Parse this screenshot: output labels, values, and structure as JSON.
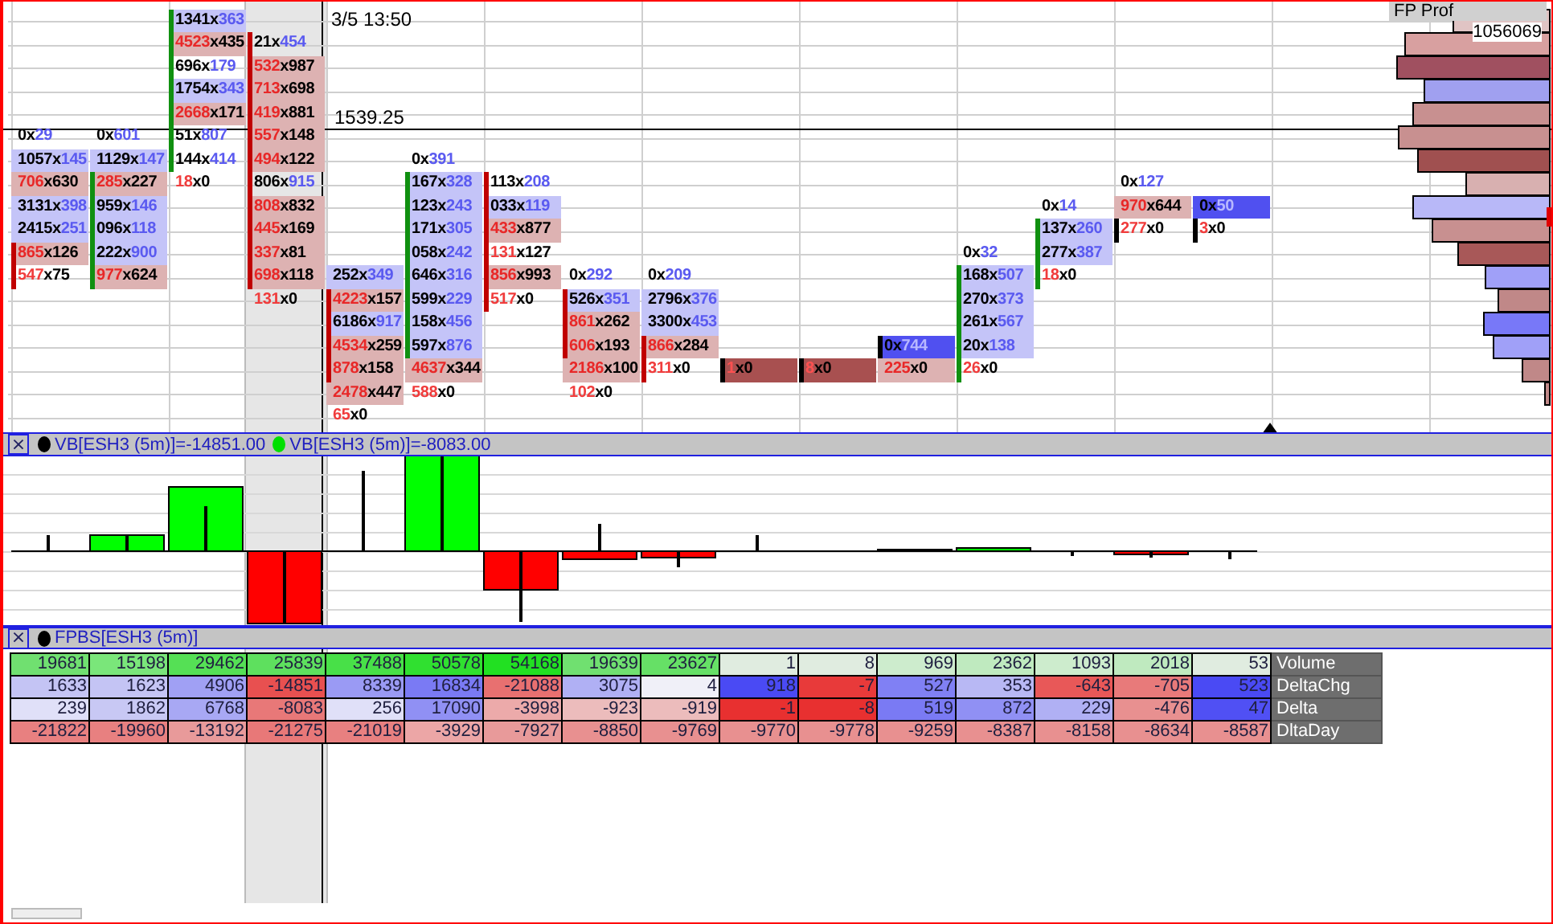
{
  "crosshair": {
    "time": "3/5 13:50",
    "price": "1539.25"
  },
  "profile": {
    "title": "FP Prof",
    "total": "1056069"
  },
  "footprint": {
    "columns": [
      {
        "kind": "down",
        "selected": false,
        "cells": [
          {
            "bid": "0",
            "sep": "x",
            "ask": "29",
            "kind": "buy",
            "body": false
          },
          {
            "bid": "1057",
            "sep": "x",
            "ask": "145",
            "kind": "buy_shaded",
            "body": false
          },
          {
            "bid": "706",
            "sep": "x",
            "ask": "630",
            "kind": "sell_shaded",
            "body": false
          },
          {
            "bid": "3131",
            "sep": "x",
            "ask": "398",
            "kind": "buy_shaded",
            "body": false
          },
          {
            "bid": "2415",
            "sep": "x",
            "ask": "251",
            "kind": "buy_shaded",
            "body": false
          },
          {
            "bid": "865",
            "sep": "x",
            "ask": "126",
            "kind": "sell_shaded",
            "body": true
          },
          {
            "bid": "547",
            "sep": "x",
            "ask": "75",
            "kind": "sell",
            "body": true
          }
        ]
      },
      {
        "kind": "up",
        "selected": false,
        "cells": [
          {
            "bid": "0",
            "sep": "x",
            "ask": "601",
            "kind": "buy",
            "body": false
          },
          {
            "bid": "1129",
            "sep": "x",
            "ask": "147",
            "kind": "buy_shaded",
            "body": false
          },
          {
            "bid": "285",
            "sep": "x",
            "ask": "227",
            "kind": "sell_shaded",
            "body": true
          },
          {
            "bid": "959",
            "sep": "x",
            "ask": "146",
            "kind": "buy_shaded",
            "body": true
          },
          {
            "bid": "096",
            "sep": "x",
            "ask": "118",
            "kind": "buy_shaded",
            "body": true
          },
          {
            "bid": "222",
            "sep": "x",
            "ask": "900",
            "kind": "buy_shaded",
            "body": true
          },
          {
            "bid": "977",
            "sep": "x",
            "ask": "624",
            "kind": "sell_shaded",
            "body": true
          }
        ]
      },
      {
        "kind": "up",
        "selected": false,
        "cells": [
          {
            "bid": "1341",
            "sep": "x",
            "ask": "363",
            "kind": "buy_shaded",
            "body": true
          },
          {
            "bid": "4523",
            "sep": "x",
            "ask": "435",
            "kind": "sell_shaded",
            "body": true
          },
          {
            "bid": "696",
            "sep": "x",
            "ask": "179",
            "kind": "buy",
            "body": true
          },
          {
            "bid": "1754",
            "sep": "x",
            "ask": "343",
            "kind": "buy_shaded",
            "body": true
          },
          {
            "bid": "2668",
            "sep": "x",
            "ask": "171",
            "kind": "sell_shaded",
            "body": true
          },
          {
            "bid": "51",
            "sep": "x",
            "ask": "807",
            "kind": "buy",
            "body": true
          },
          {
            "bid": "144",
            "sep": "x",
            "ask": "414",
            "kind": "buy",
            "body": true
          },
          {
            "bid": "18",
            "sep": "x",
            "ask": "0",
            "kind": "sell",
            "body": false
          }
        ]
      },
      {
        "kind": "down",
        "selected": true,
        "cells": [
          {
            "bid": "21",
            "sep": "x",
            "ask": "454",
            "kind": "buy",
            "body": true
          },
          {
            "bid": "532",
            "sep": "x",
            "ask": "987",
            "kind": "sell_shaded",
            "body": true
          },
          {
            "bid": "713",
            "sep": "x",
            "ask": "698",
            "kind": "sell_shaded",
            "body": true
          },
          {
            "bid": "419",
            "sep": "x",
            "ask": "881",
            "kind": "sell_shaded",
            "body": true
          },
          {
            "bid": "557",
            "sep": "x",
            "ask": "148",
            "kind": "sell_shaded",
            "body": true
          },
          {
            "bid": "494",
            "sep": "x",
            "ask": "122",
            "kind": "sell_shaded",
            "body": true
          },
          {
            "bid": "806",
            "sep": "x",
            "ask": "915",
            "kind": "buy",
            "body": true
          },
          {
            "bid": "808",
            "sep": "x",
            "ask": "832",
            "kind": "sell_shaded",
            "body": true
          },
          {
            "bid": "445",
            "sep": "x",
            "ask": "169",
            "kind": "sell_shaded",
            "body": true
          },
          {
            "bid": "337",
            "sep": "x",
            "ask": "81",
            "kind": "sell_shaded",
            "body": true
          },
          {
            "bid": "698",
            "sep": "x",
            "ask": "118",
            "kind": "sell_shaded",
            "body": true
          },
          {
            "bid": "131",
            "sep": "x",
            "ask": "0",
            "kind": "sell",
            "body": false
          }
        ]
      },
      {
        "kind": "down",
        "selected": false,
        "cells": [
          {
            "bid": "252",
            "sep": "x",
            "ask": "349",
            "kind": "buy_shaded",
            "body": false
          },
          {
            "bid": "4223",
            "sep": "x",
            "ask": "157",
            "kind": "sell_shaded",
            "body": true
          },
          {
            "bid": "6186",
            "sep": "x",
            "ask": "917",
            "kind": "buy_shaded",
            "body": true
          },
          {
            "bid": "4534",
            "sep": "x",
            "ask": "259",
            "kind": "sell_shaded",
            "body": true
          },
          {
            "bid": "878",
            "sep": "x",
            "ask": "158",
            "kind": "sell_shaded",
            "body": true
          },
          {
            "bid": "2478",
            "sep": "x",
            "ask": "447",
            "kind": "sell_shaded",
            "body": false
          },
          {
            "bid": "65",
            "sep": "x",
            "ask": "0",
            "kind": "sell",
            "body": false
          }
        ]
      },
      {
        "kind": "up",
        "selected": false,
        "cells": [
          {
            "bid": "0",
            "sep": "x",
            "ask": "391",
            "kind": "buy",
            "body": false
          },
          {
            "bid": "167",
            "sep": "x",
            "ask": "328",
            "kind": "buy_shaded",
            "body": true
          },
          {
            "bid": "123",
            "sep": "x",
            "ask": "243",
            "kind": "buy_shaded",
            "body": true
          },
          {
            "bid": "171",
            "sep": "x",
            "ask": "305",
            "kind": "buy_shaded",
            "body": true
          },
          {
            "bid": "058",
            "sep": "x",
            "ask": "242",
            "kind": "buy_shaded",
            "body": true
          },
          {
            "bid": "646",
            "sep": "x",
            "ask": "316",
            "kind": "buy_shaded",
            "body": true
          },
          {
            "bid": "599",
            "sep": "x",
            "ask": "229",
            "kind": "buy_shaded",
            "body": true
          },
          {
            "bid": "158",
            "sep": "x",
            "ask": "456",
            "kind": "buy_shaded",
            "body": true
          },
          {
            "bid": "597",
            "sep": "x",
            "ask": "876",
            "kind": "buy_shaded",
            "body": true
          },
          {
            "bid": "4637",
            "sep": "x",
            "ask": "344",
            "kind": "sell_shaded",
            "body": false
          },
          {
            "bid": "588",
            "sep": "x",
            "ask": "0",
            "kind": "sell",
            "body": false
          }
        ]
      },
      {
        "kind": "down",
        "selected": false,
        "cells": [
          {
            "bid": "113",
            "sep": "x",
            "ask": "208",
            "kind": "buy",
            "body": true
          },
          {
            "bid": "033",
            "sep": "x",
            "ask": "119",
            "kind": "buy_shaded",
            "body": true
          },
          {
            "bid": "433",
            "sep": "x",
            "ask": "877",
            "kind": "sell_shaded",
            "body": true
          },
          {
            "bid": "131",
            "sep": "x",
            "ask": "127",
            "kind": "sell",
            "body": true
          },
          {
            "bid": "856",
            "sep": "x",
            "ask": "993",
            "kind": "sell_shaded",
            "body": true
          },
          {
            "bid": "517",
            "sep": "x",
            "ask": "0",
            "kind": "sell",
            "body": true
          }
        ]
      },
      {
        "kind": "down",
        "selected": false,
        "cells": [
          {
            "bid": "0",
            "sep": "x",
            "ask": "292",
            "kind": "buy",
            "body": false
          },
          {
            "bid": "526",
            "sep": "x",
            "ask": "351",
            "kind": "buy_shaded",
            "body": true
          },
          {
            "bid": "861",
            "sep": "x",
            "ask": "262",
            "kind": "sell_shaded",
            "body": true
          },
          {
            "bid": "606",
            "sep": "x",
            "ask": "193",
            "kind": "sell_shaded",
            "body": true
          },
          {
            "bid": "2186",
            "sep": "x",
            "ask": "100",
            "kind": "sell_shaded",
            "body": false
          },
          {
            "bid": "102",
            "sep": "x",
            "ask": "0",
            "kind": "sell",
            "body": false
          }
        ]
      },
      {
        "kind": "down",
        "selected": false,
        "cells": [
          {
            "bid": "0",
            "sep": "x",
            "ask": "209",
            "kind": "buy",
            "body": false
          },
          {
            "bid": "2796",
            "sep": "x",
            "ask": "376",
            "kind": "buy_shaded",
            "body": false
          },
          {
            "bid": "3300",
            "sep": "x",
            "ask": "453",
            "kind": "buy_shaded",
            "body": false
          },
          {
            "bid": "866",
            "sep": "x",
            "ask": "284",
            "kind": "sell_shaded",
            "body": true
          },
          {
            "bid": "311",
            "sep": "x",
            "ask": "0",
            "kind": "sell",
            "body": true
          }
        ]
      },
      {
        "kind": "flat",
        "selected": false,
        "cells": [
          {
            "bid": "1",
            "sep": "x",
            "ask": "0",
            "kind": "sell_block",
            "body": true
          }
        ]
      },
      {
        "kind": "flat",
        "selected": false,
        "cells": [
          {
            "bid": "8",
            "sep": "x",
            "ask": "0",
            "kind": "sell_block",
            "body": true
          }
        ]
      },
      {
        "kind": "flat",
        "selected": false,
        "cells": [
          {
            "bid": "0",
            "sep": "x",
            "ask": "744",
            "kind": "buy_block",
            "body": true
          },
          {
            "bid": "225",
            "sep": "x",
            "ask": "0",
            "kind": "sell_shaded",
            "body": false
          }
        ]
      },
      {
        "kind": "up",
        "selected": false,
        "cells": [
          {
            "bid": "0",
            "sep": "x",
            "ask": "32",
            "kind": "buy",
            "body": false
          },
          {
            "bid": "168",
            "sep": "x",
            "ask": "507",
            "kind": "buy_shaded",
            "body": true
          },
          {
            "bid": "270",
            "sep": "x",
            "ask": "373",
            "kind": "buy_shaded",
            "body": true
          },
          {
            "bid": "261",
            "sep": "x",
            "ask": "567",
            "kind": "buy_shaded",
            "body": true
          },
          {
            "bid": "20",
            "sep": "x",
            "ask": "138",
            "kind": "buy_shaded",
            "body": true
          },
          {
            "bid": "26",
            "sep": "x",
            "ask": "0",
            "kind": "sell",
            "body": true
          }
        ]
      },
      {
        "kind": "up",
        "selected": false,
        "cells": [
          {
            "bid": "0",
            "sep": "x",
            "ask": "14",
            "kind": "buy",
            "body": false
          },
          {
            "bid": "137",
            "sep": "x",
            "ask": "260",
            "kind": "buy_shaded",
            "body": true
          },
          {
            "bid": "277",
            "sep": "x",
            "ask": "387",
            "kind": "buy_shaded",
            "body": true
          },
          {
            "bid": "18",
            "sep": "x",
            "ask": "0",
            "kind": "sell",
            "body": true
          }
        ]
      },
      {
        "kind": "flat",
        "selected": false,
        "cells": [
          {
            "bid": "0",
            "sep": "x",
            "ask": "127",
            "kind": "buy",
            "body": false
          },
          {
            "bid": "970",
            "sep": "x",
            "ask": "644",
            "kind": "sell_shaded",
            "body": false
          },
          {
            "bid": "277",
            "sep": "x",
            "ask": "0",
            "kind": "sell",
            "body": true
          }
        ]
      },
      {
        "kind": "flat",
        "selected": false,
        "cells": [
          {
            "bid": "0",
            "sep": "x",
            "ask": "50",
            "kind": "buy_block",
            "body": false
          },
          {
            "bid": "3",
            "sep": "x",
            "ask": "0",
            "kind": "sell",
            "body": true
          }
        ]
      }
    ]
  },
  "panels": [
    {
      "close": "×",
      "legend": [
        {
          "text": "VB[ESH3 (5m)]=-14851.00",
          "color": "#000000"
        },
        {
          "text": "VB[ESH3 (5m)]=-8083.00",
          "color": "#00e000"
        }
      ]
    },
    {
      "close": "×",
      "legend": [
        {
          "text": "FPBS[ESH3 (5m)]",
          "color": "#000000"
        }
      ]
    }
  ],
  "table": {
    "rows": [
      {
        "label": "Volume",
        "cells": [
          {
            "text": "19681",
            "color": "#70e070"
          },
          {
            "text": "15198",
            "color": "#7ae67a"
          },
          {
            "text": "29462",
            "color": "#55e055"
          },
          {
            "text": "25839",
            "color": "#5ee05e"
          },
          {
            "text": "37488",
            "color": "#48e048"
          },
          {
            "text": "50578",
            "color": "#30e030"
          },
          {
            "text": "54168",
            "color": "#22e022"
          },
          {
            "text": "19639",
            "color": "#70e070"
          },
          {
            "text": "23627",
            "color": "#66e066"
          },
          {
            "text": "1",
            "color": "#e0ece0"
          },
          {
            "text": "8",
            "color": "#e0ece0"
          },
          {
            "text": "969",
            "color": "#cdeccd"
          },
          {
            "text": "2362",
            "color": "#bfeabf"
          },
          {
            "text": "1093",
            "color": "#cdeccd"
          },
          {
            "text": "2018",
            "color": "#bfeabf"
          },
          {
            "text": "53",
            "color": "#e0ece0"
          }
        ]
      },
      {
        "label": "DeltaChg",
        "cells": [
          {
            "text": "1633",
            "color": "#c4c4f4"
          },
          {
            "text": "1623",
            "color": "#c4c4f4"
          },
          {
            "text": "4906",
            "color": "#a0a0f4"
          },
          {
            "text": "-14851",
            "color": "#e85050"
          },
          {
            "text": "8339",
            "color": "#9a9af4"
          },
          {
            "text": "16834",
            "color": "#7a7af4"
          },
          {
            "text": "-21088",
            "color": "#e87070"
          },
          {
            "text": "3075",
            "color": "#b0b0f4"
          },
          {
            "text": "4",
            "color": "#f0f0f8"
          },
          {
            "text": "918",
            "color": "#4a4af4"
          },
          {
            "text": "-7",
            "color": "#e83a3a"
          },
          {
            "text": "527",
            "color": "#8080f4"
          },
          {
            "text": "353",
            "color": "#b8b8f4"
          },
          {
            "text": "-643",
            "color": "#e85858"
          },
          {
            "text": "-705",
            "color": "#e87a7a"
          },
          {
            "text": "523",
            "color": "#4a4af4"
          }
        ]
      },
      {
        "label": "Delta",
        "cells": [
          {
            "text": "239",
            "color": "#e0e0f8"
          },
          {
            "text": "1862",
            "color": "#c8c8f4"
          },
          {
            "text": "6768",
            "color": "#a8a8f4"
          },
          {
            "text": "-8083",
            "color": "#e87878"
          },
          {
            "text": "256",
            "color": "#e0e0f8"
          },
          {
            "text": "17090",
            "color": "#9090f4"
          },
          {
            "text": "-3998",
            "color": "#ecaaaa"
          },
          {
            "text": "-923",
            "color": "#ecbcbc"
          },
          {
            "text": "-919",
            "color": "#ecbcbc"
          },
          {
            "text": "-1",
            "color": "#e83030"
          },
          {
            "text": "-8",
            "color": "#e83030"
          },
          {
            "text": "519",
            "color": "#7a7af4"
          },
          {
            "text": "872",
            "color": "#9090f4"
          },
          {
            "text": "229",
            "color": "#b0b0f4"
          },
          {
            "text": "-476",
            "color": "#e89090"
          },
          {
            "text": "47",
            "color": "#5050f4"
          }
        ]
      },
      {
        "label": "DltaDay",
        "cells": [
          {
            "text": "-21822",
            "color": "#e88080"
          },
          {
            "text": "-19960",
            "color": "#e88080"
          },
          {
            "text": "-13192",
            "color": "#e89a9a"
          },
          {
            "text": "-21275",
            "color": "#e87878"
          },
          {
            "text": "-21019",
            "color": "#e88080"
          },
          {
            "text": "-3929",
            "color": "#eca6a6"
          },
          {
            "text": "-7927",
            "color": "#e89a9a"
          },
          {
            "text": "-8850",
            "color": "#e89090"
          },
          {
            "text": "-9769",
            "color": "#e89090"
          },
          {
            "text": "-9770",
            "color": "#e89090"
          },
          {
            "text": "-9778",
            "color": "#e89090"
          },
          {
            "text": "-9259",
            "color": "#e89090"
          },
          {
            "text": "-8387",
            "color": "#e89090"
          },
          {
            "text": "-8158",
            "color": "#e89090"
          },
          {
            "text": "-8634",
            "color": "#e89090"
          },
          {
            "text": "-8587",
            "color": "#e89090"
          }
        ]
      }
    ]
  }
}
